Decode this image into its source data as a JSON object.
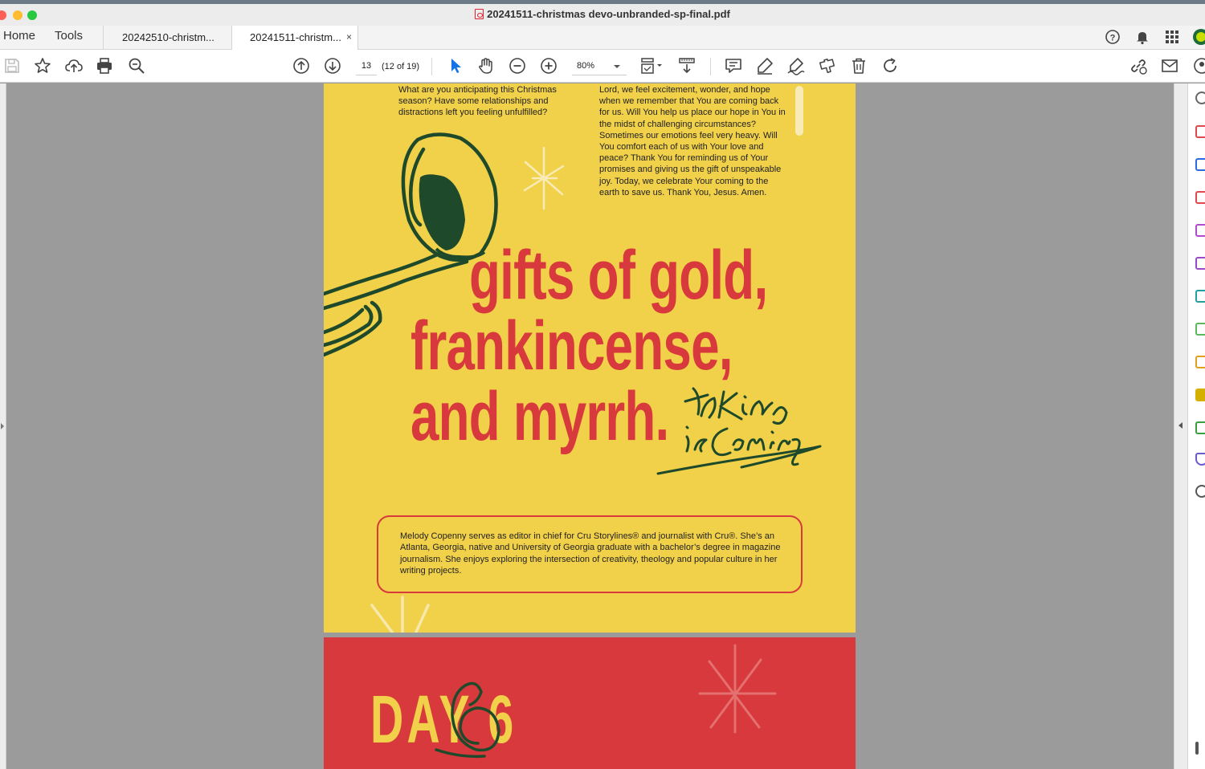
{
  "window": {
    "title": "20241511-christmas devo-unbranded-sp-final.pdf"
  },
  "nav": {
    "home": "Home",
    "tools": "Tools"
  },
  "tabs": [
    {
      "label": "20242510-christm..."
    },
    {
      "label": "20241511-christm...",
      "close": "×",
      "active": true
    }
  ],
  "toolbar": {
    "page_number": "13",
    "page_count": "(12 of 19)",
    "zoom": "80%"
  },
  "page1": {
    "left_column": "What are you anticipating this Christmas season? Have some relationships and distractions left you feeling unfulfilled?",
    "prayer": "Lord, we feel excitement, wonder, and hope when we remember that You are coming back for us. Will You help us place our hope in You in the midst of challenging circumstances? Sometimes our emotions feel very heavy. Will You comfort each of us with Your love and peace? Thank You for reminding us of Your promises and giving us the gift of unspeakable joy. Today, we celebrate Your coming to the earth to save us. Thank You, Jesus. Amen.",
    "headline": [
      "gifts of gold,",
      "frankincense,",
      "and myrrh."
    ],
    "script": [
      "the King",
      "is Coming"
    ],
    "bio": "Melody Copenny serves as editor in chief for Cru Storylines® and journalist with Cru®. She’s an Atlanta, Georgia, native and University of Georgia graduate with a bachelor’s degree in magazine journalism. She enjoys exploring the intersection of creativity, theology and popular culture in her writing projects."
  },
  "page2": {
    "day_label": "DAY 6"
  },
  "colors": {
    "page_yellow": "#f1d04a",
    "page_red": "#d8393c",
    "ink_green": "#1e4a2b",
    "accent_blue": "#1473e6"
  }
}
